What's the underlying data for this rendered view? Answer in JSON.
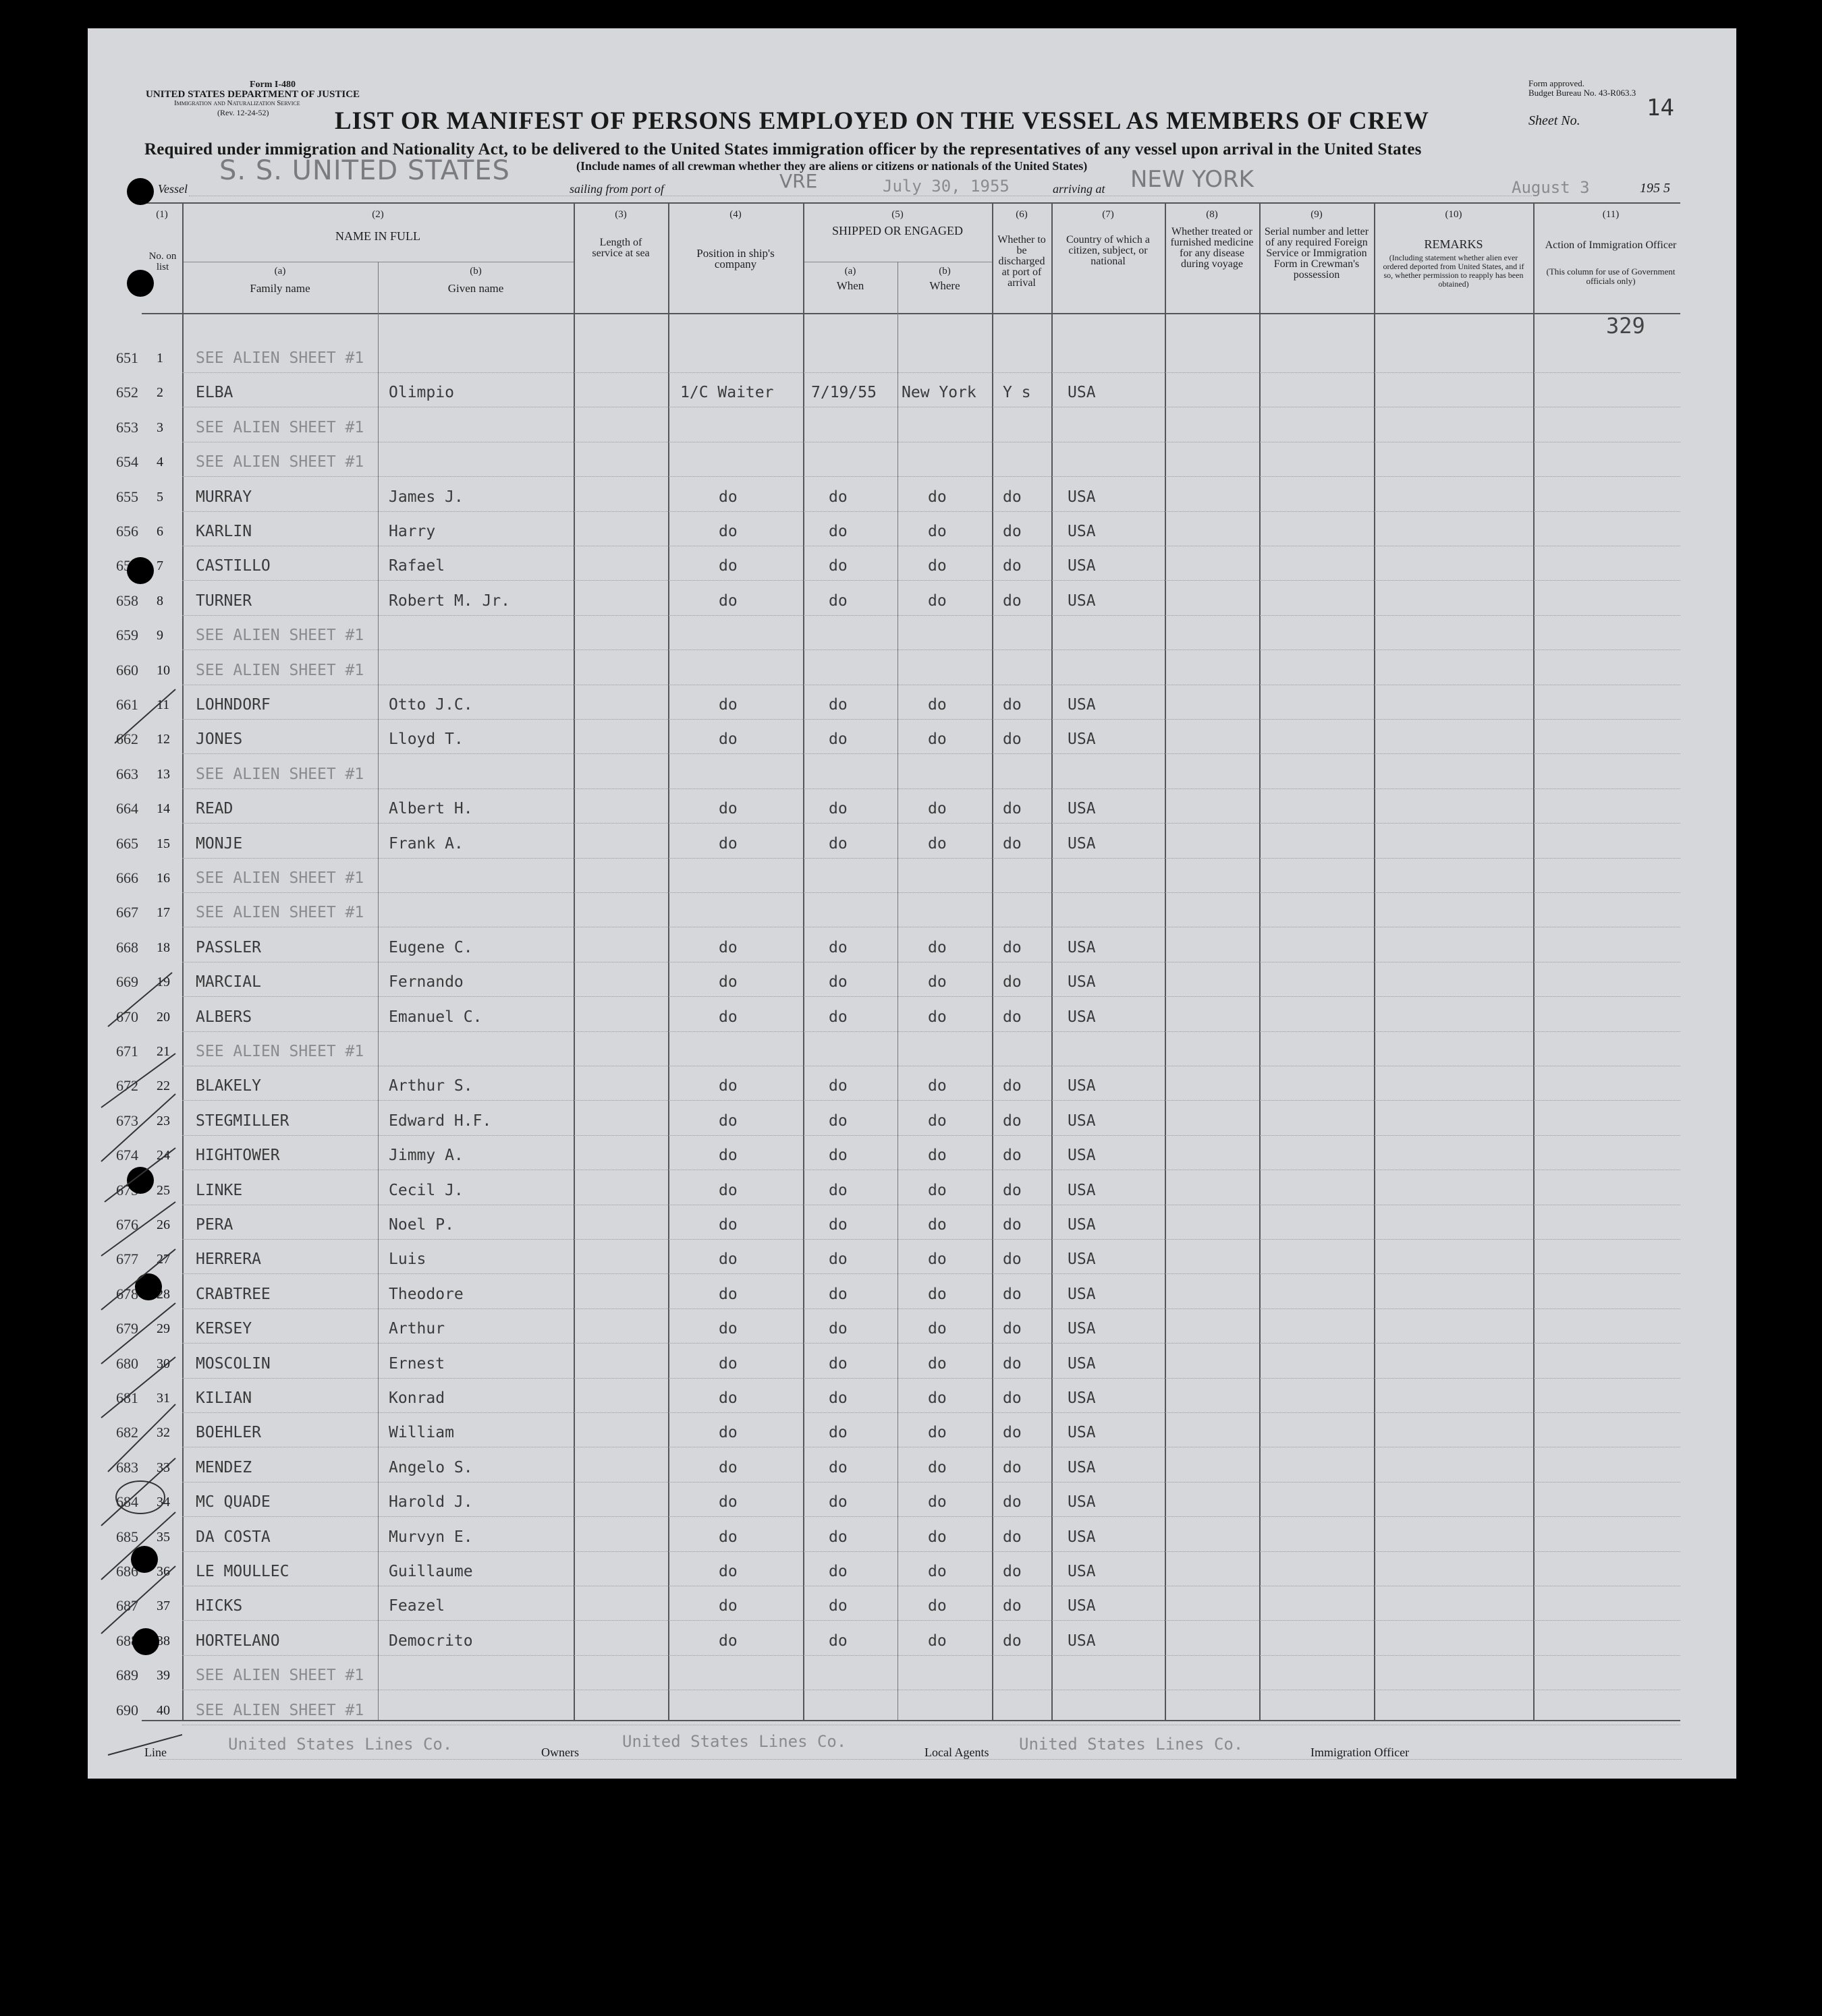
{
  "form": {
    "form_no": "Form I-480",
    "department": "UNITED STATES DEPARTMENT OF JUSTICE",
    "service": "Immigration and Naturalization Service",
    "revision": "(Rev. 12-24-52)",
    "approval_line1": "Form approved.",
    "approval_line2": "Budget Bureau No. 43-R063.3",
    "title": "LIST OR MANIFEST OF PERSONS EMPLOYED ON THE VESSEL AS MEMBERS OF CREW",
    "sheet_label": "Sheet No.",
    "sheet_no": "14",
    "subtitle": "Required under immigration and Nationality Act, to be delivered to the United States immigration officer by the representatives of any vessel upon arrival in the United States",
    "note": "(Include names of all crewman whether they are aliens or citizens or nationals of the United States)",
    "vessel_label": "Vessel",
    "vessel": "S. S. UNITED STATES",
    "sailing_label": "sailing from port of",
    "sailing_port": "VRE",
    "sailing_date": "July 30, 1955",
    "arriving_label": "arriving at",
    "arriving_port": "NEW YORK",
    "arrival_date": "August 3",
    "arrival_year": "195 5",
    "stamp_number": "329"
  },
  "columns": {
    "c1_num": "(1)",
    "c1_label": "No. on list",
    "c2_num": "(2)",
    "c2_label": "NAME IN FULL",
    "c2a_num": "(a)",
    "c2a_label": "Family name",
    "c2b_num": "(b)",
    "c2b_label": "Given name",
    "c3_num": "(3)",
    "c3_label": "Length of service at sea",
    "c4_num": "(4)",
    "c4_label": "Position in ship's company",
    "c5_num": "(5)",
    "c5_label": "SHIPPED OR ENGAGED",
    "c5a_num": "(a)",
    "c5a_label": "When",
    "c5b_num": "(b)",
    "c5b_label": "Where",
    "c6_num": "(6)",
    "c6_label": "Whether to be discharged at port of arrival",
    "c7_num": "(7)",
    "c7_label": "Country of which a citizen, subject, or national",
    "c8_num": "(8)",
    "c8_label": "Whether treated or furnished medicine for any disease during voyage",
    "c9_num": "(9)",
    "c9_label": "Serial number and letter of any required Foreign Service or Immigration Form in Crewman's possession",
    "c10_num": "(10)",
    "c10_label": "REMARKS",
    "c10_note": "(Including statement whether alien ever ordered deported from United States, and if so, whether permission to reapply has been obtained)",
    "c11_num": "(11)",
    "c11_label": "Action of Immigration Officer",
    "c11_note": "(This column for use of Government officials only)"
  },
  "rows": [
    {
      "hand": "651",
      "no": "1",
      "family": "SEE ALIEN SHEET #1",
      "given": "",
      "position": "",
      "when": "",
      "where": "",
      "discharged": "",
      "country": "",
      "alien": true
    },
    {
      "hand": "652",
      "no": "2",
      "family": "ELBA",
      "given": "Olimpio",
      "position": "1/C Waiter",
      "when": "7/19/55",
      "where": "New York",
      "discharged": "Y s",
      "country": "USA",
      "alien": false
    },
    {
      "hand": "653",
      "no": "3",
      "family": "SEE ALIEN SHEET #1",
      "given": "",
      "position": "",
      "when": "",
      "where": "",
      "discharged": "",
      "country": "",
      "alien": true
    },
    {
      "hand": "654",
      "no": "4",
      "family": "SEE ALIEN SHEET #1",
      "given": "",
      "position": "",
      "when": "",
      "where": "",
      "discharged": "",
      "country": "",
      "alien": true
    },
    {
      "hand": "655",
      "no": "5",
      "family": "MURRAY",
      "given": "James J.",
      "position": "do",
      "when": "do",
      "where": "do",
      "discharged": "do",
      "country": "USA",
      "alien": false
    },
    {
      "hand": "656",
      "no": "6",
      "family": "KARLIN",
      "given": "Harry",
      "position": "do",
      "when": "do",
      "where": "do",
      "discharged": "do",
      "country": "USA",
      "alien": false
    },
    {
      "hand": "657",
      "no": "7",
      "family": "CASTILLO",
      "given": "Rafael",
      "position": "do",
      "when": "do",
      "where": "do",
      "discharged": "do",
      "country": "USA",
      "alien": false
    },
    {
      "hand": "658",
      "no": "8",
      "family": "TURNER",
      "given": "Robert M. Jr.",
      "position": "do",
      "when": "do",
      "where": "do",
      "discharged": "do",
      "country": "USA",
      "alien": false
    },
    {
      "hand": "659",
      "no": "9",
      "family": "SEE ALIEN SHEET #1",
      "given": "",
      "position": "",
      "when": "",
      "where": "",
      "discharged": "",
      "country": "",
      "alien": true
    },
    {
      "hand": "660",
      "no": "10",
      "family": "SEE ALIEN SHEET #1",
      "given": "",
      "position": "",
      "when": "",
      "where": "",
      "discharged": "",
      "country": "",
      "alien": true
    },
    {
      "hand": "661",
      "no": "11",
      "family": "LOHNDORF",
      "given": "Otto J.C.",
      "position": "do",
      "when": "do",
      "where": "do",
      "discharged": "do",
      "country": "USA",
      "alien": false
    },
    {
      "hand": "662",
      "no": "12",
      "family": "JONES",
      "given": "Lloyd T.",
      "position": "do",
      "when": "do",
      "where": "do",
      "discharged": "do",
      "country": "USA",
      "alien": false
    },
    {
      "hand": "663",
      "no": "13",
      "family": "SEE ALIEN SHEET #1",
      "given": "",
      "position": "",
      "when": "",
      "where": "",
      "discharged": "",
      "country": "",
      "alien": true
    },
    {
      "hand": "664",
      "no": "14",
      "family": "READ",
      "given": "Albert H.",
      "position": "do",
      "when": "do",
      "where": "do",
      "discharged": "do",
      "country": "USA",
      "alien": false
    },
    {
      "hand": "665",
      "no": "15",
      "family": "MONJE",
      "given": "Frank A.",
      "position": "do",
      "when": "do",
      "where": "do",
      "discharged": "do",
      "country": "USA",
      "alien": false
    },
    {
      "hand": "666",
      "no": "16",
      "family": "SEE ALIEN SHEET #1",
      "given": "",
      "position": "",
      "when": "",
      "where": "",
      "discharged": "",
      "country": "",
      "alien": true
    },
    {
      "hand": "667",
      "no": "17",
      "family": "SEE ALIEN SHEET #1",
      "given": "",
      "position": "",
      "when": "",
      "where": "",
      "discharged": "",
      "country": "",
      "alien": true
    },
    {
      "hand": "668",
      "no": "18",
      "family": "PASSLER",
      "given": "Eugene C.",
      "position": "do",
      "when": "do",
      "where": "do",
      "discharged": "do",
      "country": "USA",
      "alien": false
    },
    {
      "hand": "669",
      "no": "19",
      "family": "MARCIAL",
      "given": "Fernando",
      "position": "do",
      "when": "do",
      "where": "do",
      "discharged": "do",
      "country": "USA",
      "alien": false
    },
    {
      "hand": "670",
      "no": "20",
      "family": "ALBERS",
      "given": "Emanuel C.",
      "position": "do",
      "when": "do",
      "where": "do",
      "discharged": "do",
      "country": "USA",
      "alien": false
    },
    {
      "hand": "671",
      "no": "21",
      "family": "SEE ALIEN SHEET #1",
      "given": "",
      "position": "",
      "when": "",
      "where": "",
      "discharged": "",
      "country": "",
      "alien": true
    },
    {
      "hand": "672",
      "no": "22",
      "family": "BLAKELY",
      "given": "Arthur S.",
      "position": "do",
      "when": "do",
      "where": "do",
      "discharged": "do",
      "country": "USA",
      "alien": false
    },
    {
      "hand": "673",
      "no": "23",
      "family": "STEGMILLER",
      "given": "Edward H.F.",
      "position": "do",
      "when": "do",
      "where": "do",
      "discharged": "do",
      "country": "USA",
      "alien": false
    },
    {
      "hand": "674",
      "no": "24",
      "family": "HIGHTOWER",
      "given": "Jimmy A.",
      "position": "do",
      "when": "do",
      "where": "do",
      "discharged": "do",
      "country": "USA",
      "alien": false
    },
    {
      "hand": "675",
      "no": "25",
      "family": "LINKE",
      "given": "Cecil J.",
      "position": "do",
      "when": "do",
      "where": "do",
      "discharged": "do",
      "country": "USA",
      "alien": false
    },
    {
      "hand": "676",
      "no": "26",
      "family": "PERA",
      "given": "Noel P.",
      "position": "do",
      "when": "do",
      "where": "do",
      "discharged": "do",
      "country": "USA",
      "alien": false
    },
    {
      "hand": "677",
      "no": "27",
      "family": "HERRERA",
      "given": "Luis",
      "position": "do",
      "when": "do",
      "where": "do",
      "discharged": "do",
      "country": "USA",
      "alien": false
    },
    {
      "hand": "678",
      "no": "28",
      "family": "CRABTREE",
      "given": "Theodore",
      "position": "do",
      "when": "do",
      "where": "do",
      "discharged": "do",
      "country": "USA",
      "alien": false
    },
    {
      "hand": "679",
      "no": "29",
      "family": "KERSEY",
      "given": "Arthur",
      "position": "do",
      "when": "do",
      "where": "do",
      "discharged": "do",
      "country": "USA",
      "alien": false
    },
    {
      "hand": "680",
      "no": "30",
      "family": "MOSCOLIN",
      "given": "Ernest",
      "position": "do",
      "when": "do",
      "where": "do",
      "discharged": "do",
      "country": "USA",
      "alien": false
    },
    {
      "hand": "681",
      "no": "31",
      "family": "KILIAN",
      "given": "Konrad",
      "position": "do",
      "when": "do",
      "where": "do",
      "discharged": "do",
      "country": "USA",
      "alien": false
    },
    {
      "hand": "682",
      "no": "32",
      "family": "BOEHLER",
      "given": "William",
      "position": "do",
      "when": "do",
      "where": "do",
      "discharged": "do",
      "country": "USA",
      "alien": false
    },
    {
      "hand": "683",
      "no": "33",
      "family": "MENDEZ",
      "given": "Angelo S.",
      "position": "do",
      "when": "do",
      "where": "do",
      "discharged": "do",
      "country": "USA",
      "alien": false
    },
    {
      "hand": "684",
      "no": "34",
      "family": "MC QUADE",
      "given": "Harold J.",
      "position": "do",
      "when": "do",
      "where": "do",
      "discharged": "do",
      "country": "USA",
      "alien": false
    },
    {
      "hand": "685",
      "no": "35",
      "family": "DA COSTA",
      "given": "Murvyn E.",
      "position": "do",
      "when": "do",
      "where": "do",
      "discharged": "do",
      "country": "USA",
      "alien": false
    },
    {
      "hand": "686",
      "no": "36",
      "family": "LE MOULLEC",
      "given": "Guillaume",
      "position": "do",
      "when": "do",
      "where": "do",
      "discharged": "do",
      "country": "USA",
      "alien": false
    },
    {
      "hand": "687",
      "no": "37",
      "family": "HICKS",
      "given": "Feazel",
      "position": "do",
      "when": "do",
      "where": "do",
      "discharged": "do",
      "country": "USA",
      "alien": false
    },
    {
      "hand": "688",
      "no": "38",
      "family": "HORTELANO",
      "given": "Democrito",
      "position": "do",
      "when": "do",
      "where": "do",
      "discharged": "do",
      "country": "USA",
      "alien": false
    },
    {
      "hand": "689",
      "no": "39",
      "family": "SEE ALIEN SHEET #1",
      "given": "",
      "position": "",
      "when": "",
      "where": "",
      "discharged": "",
      "country": "",
      "alien": true
    },
    {
      "hand": "690",
      "no": "40",
      "family": "SEE ALIEN SHEET #1",
      "given": "",
      "position": "",
      "when": "",
      "where": "",
      "discharged": "",
      "country": "",
      "alien": true
    }
  ],
  "footer": {
    "line_label": "Line",
    "line_value": "United States Lines Co.",
    "owners_label": "Owners",
    "owners_value": "United States Lines Co.",
    "agents_label": "Local Agents",
    "agents_value": "United States Lines Co.",
    "officer_label": "Immigration Officer"
  }
}
